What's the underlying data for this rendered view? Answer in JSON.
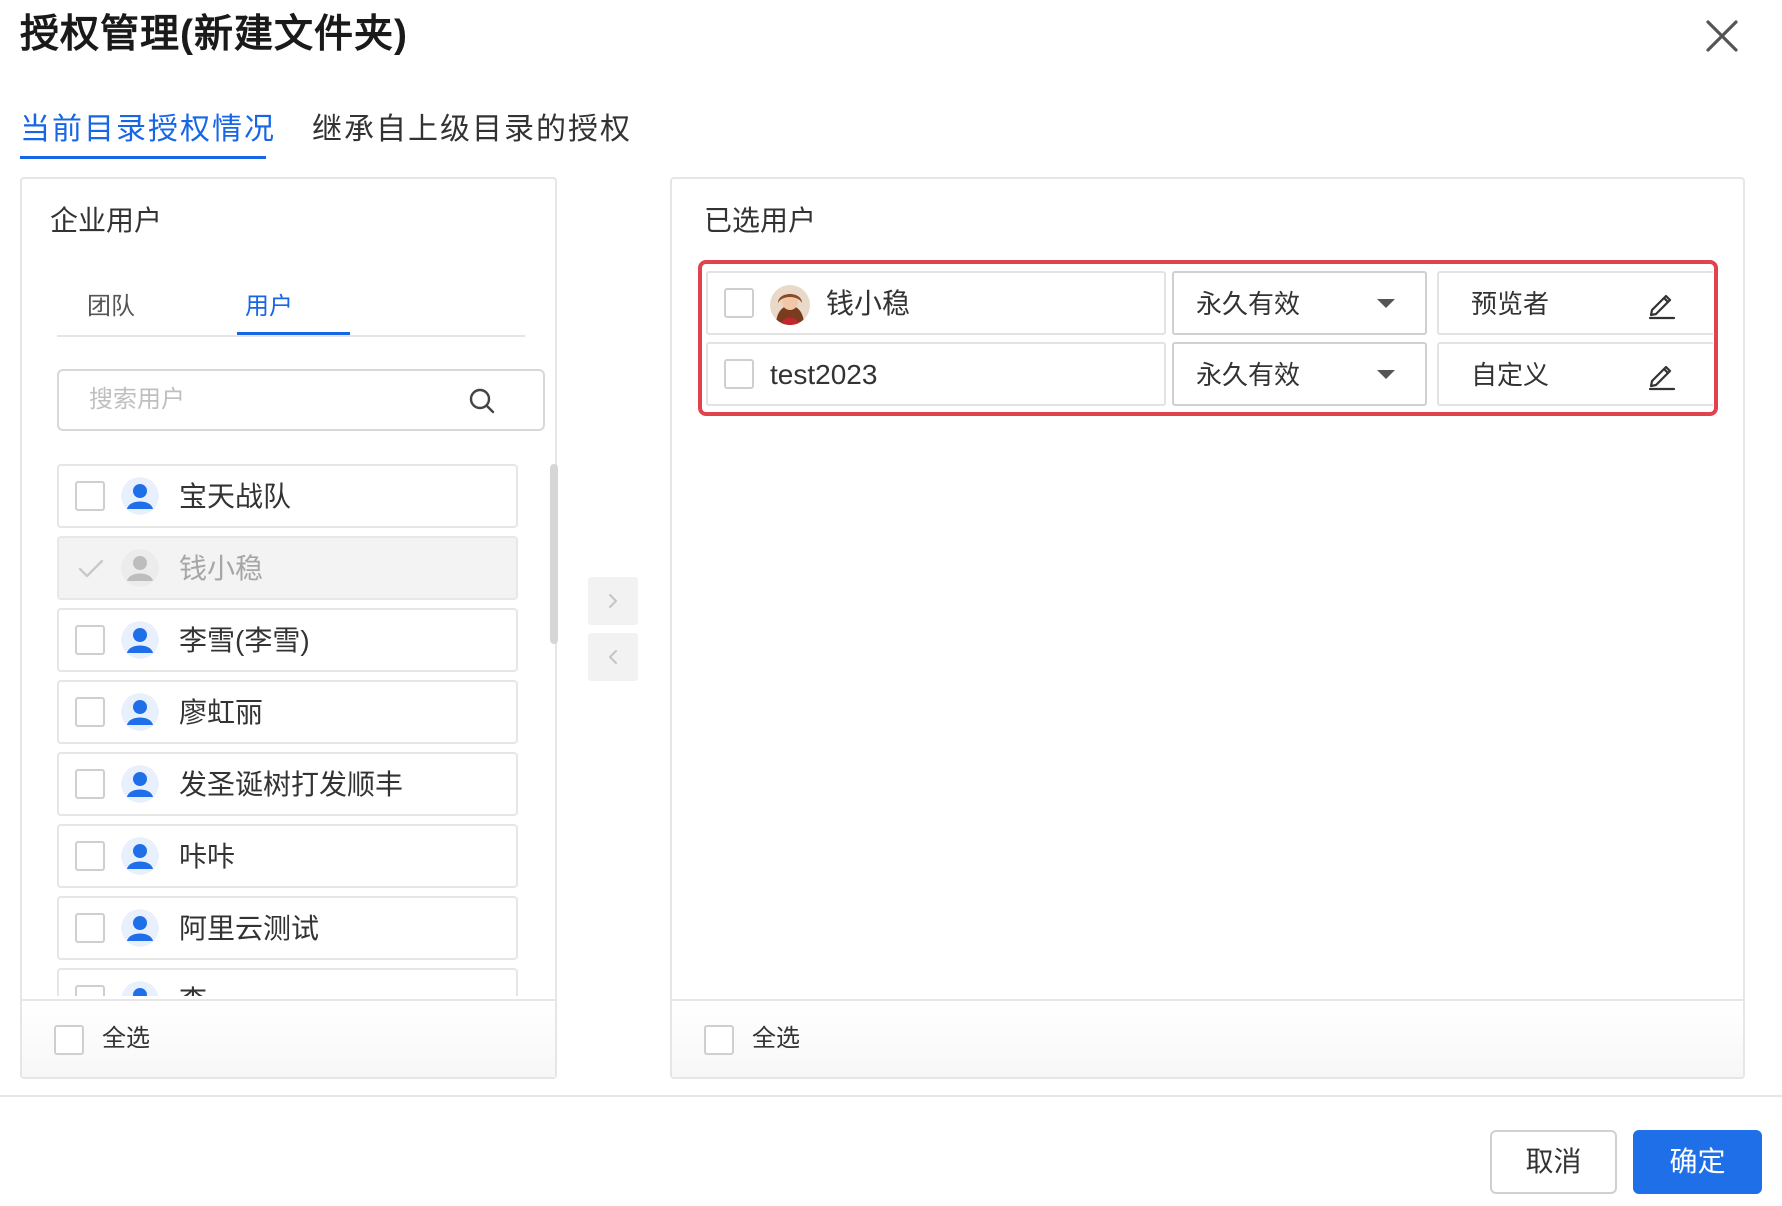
{
  "dialog": {
    "title": "授权管理(新建文件夹)",
    "close_icon": "close-icon"
  },
  "tabs": [
    {
      "label": "当前目录授权情况",
      "active": true
    },
    {
      "label": "继承自上级目录的授权",
      "active": false
    }
  ],
  "left_panel": {
    "title": "企业用户",
    "sub_tabs": [
      {
        "label": "团队",
        "active": false
      },
      {
        "label": "用户",
        "active": true
      }
    ],
    "search_placeholder": "搜索用户",
    "search_icon": "search-icon",
    "items": [
      {
        "label": "宝天战队",
        "checked": false,
        "disabled": false
      },
      {
        "label": "钱小稳",
        "checked": true,
        "disabled": true
      },
      {
        "label": "李雪(李雪)",
        "checked": false,
        "disabled": false
      },
      {
        "label": "廖虹丽",
        "checked": false,
        "disabled": false
      },
      {
        "label": "发圣诞树打发顺丰",
        "checked": false,
        "disabled": false
      },
      {
        "label": "咔咔",
        "checked": false,
        "disabled": false
      },
      {
        "label": "阿里云测试",
        "checked": false,
        "disabled": false
      },
      {
        "label": "李",
        "checked": false,
        "disabled": false
      }
    ],
    "select_all": "全选"
  },
  "transfer": {
    "right_icon": "chevron-right-icon",
    "left_icon": "chevron-left-icon"
  },
  "right_panel": {
    "title": "已选用户",
    "rows": [
      {
        "name": "钱小稳",
        "has_photo": true,
        "validity": "永久有效",
        "role": "预览者"
      },
      {
        "name": "test2023",
        "has_photo": false,
        "validity": "永久有效",
        "role": "自定义"
      }
    ],
    "select_all": "全选"
  },
  "footer": {
    "cancel_label": "取消",
    "ok_label": "确定"
  },
  "colors": {
    "accent": "#1766e6",
    "highlight_border": "#e0434d",
    "primary_button": "#1f6fe9"
  }
}
